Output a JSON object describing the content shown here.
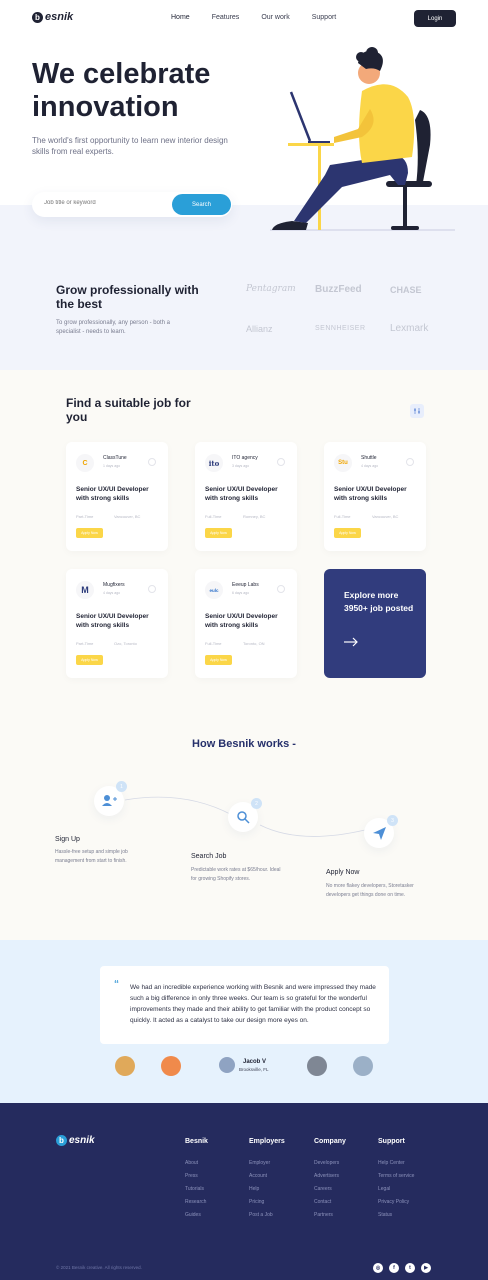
{
  "nav": {
    "logo_letter": "b",
    "logo_text": "esnik",
    "links": [
      "Home",
      "Features",
      "Our work",
      "Support"
    ],
    "login_label": "Login"
  },
  "hero": {
    "title": "We celebrate innovation",
    "subtitle": "The world's first opportunity to learn new interior design skills from real experts.",
    "search_placeholder": "Job title or keyword",
    "search_button": "Search"
  },
  "grow": {
    "title": "Grow professionally with the best",
    "subtitle": "To grow professionally, any person - both a specialist - needs to learn.",
    "brands": [
      "Pentagram",
      "BuzzFeed",
      "CHASE",
      "Allianz",
      "SENNHEISER",
      "Lexmark"
    ]
  },
  "jobs": {
    "title": "Find a suitable job for you",
    "cards": [
      {
        "logo": "C",
        "logo_color": "#f0a500",
        "company": "ClassTune",
        "ago": "1 days ago",
        "title": "Senior UX/UI Developer with strong skills",
        "type": "Part-Time",
        "location": "Vancouver, BC",
        "apply": "Apply Now"
      },
      {
        "logo": "ito",
        "logo_color": "#2b3a7a",
        "company": "ITO agency",
        "ago": "3 days ago",
        "title": "Senior UX/UI Developer with strong skills",
        "type": "Full-Time",
        "location": "Romney, BC",
        "apply": "Apply Now"
      },
      {
        "logo": "Stu",
        "logo_color": "#f0a500",
        "company": "Shuttle",
        "ago": "4 days ago",
        "title": "Senior UX/UI Developer with strong skills",
        "type": "Full-Time",
        "location": "Vancouver, BC",
        "apply": "Apply Now"
      },
      {
        "logo": "M",
        "logo_color": "#2b3a7a",
        "company": "Mugfixers",
        "ago": "4 days ago",
        "title": "Senior UX/UI Developer with strong skills",
        "type": "Part-Time",
        "location": "Ozo, Toronto",
        "apply": "Apply Now"
      },
      {
        "logo": "eulc",
        "logo_color": "#2b6fc9",
        "company": "Eeeup Labs",
        "ago": "6 days ago",
        "title": "Senior UX/UI Developer with strong skills",
        "type": "Full-Time",
        "location": "Toronto, ON",
        "apply": "Apply Now"
      }
    ],
    "explore_text": "Explore more 3950+ job posted"
  },
  "how": {
    "title": "How Besnik works -",
    "steps": [
      {
        "num": "1",
        "title": "Sign Up",
        "desc": "Hassle-free setup and simple job management from start to finish."
      },
      {
        "num": "2",
        "title": "Search Job",
        "desc": "Predictable work rates at $65/hour. Ideal for growing Shopify stores."
      },
      {
        "num": "3",
        "title": "Apply Now",
        "desc": "No more flakey developers, Storetasker developers get things done on time."
      }
    ]
  },
  "testimonial": {
    "quote_mark": "“",
    "text": "We had an incredible experience working with Besnik and were impressed they made such a big difference in only three weeks. Our team is so grateful for the wonderful improvements they made and their ability to get familiar with the product concept so quickly. It acted as a catalyst to take our design more eyes on.",
    "user_name": "Jacob V",
    "user_location": "Brooksville, FL"
  },
  "footer": {
    "logo_letter": "b",
    "logo_text": "esnik",
    "columns": [
      {
        "title": "Besnik",
        "links": [
          "About",
          "Press",
          "Tutorials",
          "Research",
          "Guides"
        ]
      },
      {
        "title": "Employers",
        "links": [
          "Employer",
          "Account",
          "Help",
          "Pricing",
          "Post a Job"
        ]
      },
      {
        "title": "Company",
        "links": [
          "Developers",
          "Advertisers",
          "Careers",
          "Contact",
          "Partners"
        ]
      },
      {
        "title": "Support",
        "links": [
          "Help Center",
          "Terms of service",
          "Legal",
          "Privacy Policy",
          "Status"
        ]
      }
    ],
    "copyright": "© 2021 Besnik creative. All rights reserved.",
    "social": [
      "instagram-icon",
      "facebook-icon",
      "twitter-icon",
      "youtube-icon"
    ]
  },
  "colors": {
    "primary_dark": "#1f2233",
    "accent_blue": "#2a9fd8",
    "accent_yellow": "#fbd648",
    "navy": "#313c7d",
    "footer_bg": "#252b5e"
  }
}
